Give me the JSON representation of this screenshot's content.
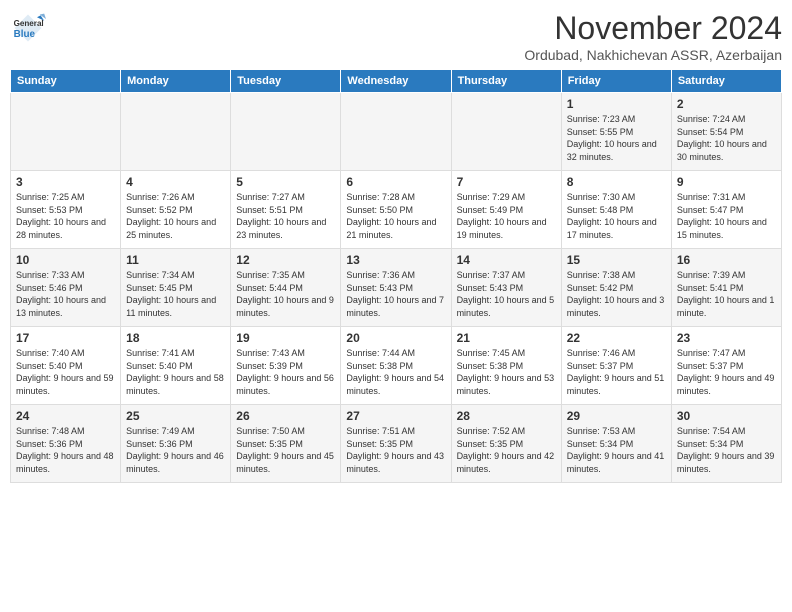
{
  "header": {
    "logo": {
      "general": "General",
      "blue": "Blue"
    },
    "title": "November 2024",
    "location": "Ordubad, Nakhichevan ASSR, Azerbaijan"
  },
  "weekdays": [
    "Sunday",
    "Monday",
    "Tuesday",
    "Wednesday",
    "Thursday",
    "Friday",
    "Saturday"
  ],
  "weeks": [
    [
      {
        "day": "",
        "info": ""
      },
      {
        "day": "",
        "info": ""
      },
      {
        "day": "",
        "info": ""
      },
      {
        "day": "",
        "info": ""
      },
      {
        "day": "",
        "info": ""
      },
      {
        "day": "1",
        "info": "Sunrise: 7:23 AM\nSunset: 5:55 PM\nDaylight: 10 hours and 32 minutes."
      },
      {
        "day": "2",
        "info": "Sunrise: 7:24 AM\nSunset: 5:54 PM\nDaylight: 10 hours and 30 minutes."
      }
    ],
    [
      {
        "day": "3",
        "info": "Sunrise: 7:25 AM\nSunset: 5:53 PM\nDaylight: 10 hours and 28 minutes."
      },
      {
        "day": "4",
        "info": "Sunrise: 7:26 AM\nSunset: 5:52 PM\nDaylight: 10 hours and 25 minutes."
      },
      {
        "day": "5",
        "info": "Sunrise: 7:27 AM\nSunset: 5:51 PM\nDaylight: 10 hours and 23 minutes."
      },
      {
        "day": "6",
        "info": "Sunrise: 7:28 AM\nSunset: 5:50 PM\nDaylight: 10 hours and 21 minutes."
      },
      {
        "day": "7",
        "info": "Sunrise: 7:29 AM\nSunset: 5:49 PM\nDaylight: 10 hours and 19 minutes."
      },
      {
        "day": "8",
        "info": "Sunrise: 7:30 AM\nSunset: 5:48 PM\nDaylight: 10 hours and 17 minutes."
      },
      {
        "day": "9",
        "info": "Sunrise: 7:31 AM\nSunset: 5:47 PM\nDaylight: 10 hours and 15 minutes."
      }
    ],
    [
      {
        "day": "10",
        "info": "Sunrise: 7:33 AM\nSunset: 5:46 PM\nDaylight: 10 hours and 13 minutes."
      },
      {
        "day": "11",
        "info": "Sunrise: 7:34 AM\nSunset: 5:45 PM\nDaylight: 10 hours and 11 minutes."
      },
      {
        "day": "12",
        "info": "Sunrise: 7:35 AM\nSunset: 5:44 PM\nDaylight: 10 hours and 9 minutes."
      },
      {
        "day": "13",
        "info": "Sunrise: 7:36 AM\nSunset: 5:43 PM\nDaylight: 10 hours and 7 minutes."
      },
      {
        "day": "14",
        "info": "Sunrise: 7:37 AM\nSunset: 5:43 PM\nDaylight: 10 hours and 5 minutes."
      },
      {
        "day": "15",
        "info": "Sunrise: 7:38 AM\nSunset: 5:42 PM\nDaylight: 10 hours and 3 minutes."
      },
      {
        "day": "16",
        "info": "Sunrise: 7:39 AM\nSunset: 5:41 PM\nDaylight: 10 hours and 1 minute."
      }
    ],
    [
      {
        "day": "17",
        "info": "Sunrise: 7:40 AM\nSunset: 5:40 PM\nDaylight: 9 hours and 59 minutes."
      },
      {
        "day": "18",
        "info": "Sunrise: 7:41 AM\nSunset: 5:40 PM\nDaylight: 9 hours and 58 minutes."
      },
      {
        "day": "19",
        "info": "Sunrise: 7:43 AM\nSunset: 5:39 PM\nDaylight: 9 hours and 56 minutes."
      },
      {
        "day": "20",
        "info": "Sunrise: 7:44 AM\nSunset: 5:38 PM\nDaylight: 9 hours and 54 minutes."
      },
      {
        "day": "21",
        "info": "Sunrise: 7:45 AM\nSunset: 5:38 PM\nDaylight: 9 hours and 53 minutes."
      },
      {
        "day": "22",
        "info": "Sunrise: 7:46 AM\nSunset: 5:37 PM\nDaylight: 9 hours and 51 minutes."
      },
      {
        "day": "23",
        "info": "Sunrise: 7:47 AM\nSunset: 5:37 PM\nDaylight: 9 hours and 49 minutes."
      }
    ],
    [
      {
        "day": "24",
        "info": "Sunrise: 7:48 AM\nSunset: 5:36 PM\nDaylight: 9 hours and 48 minutes."
      },
      {
        "day": "25",
        "info": "Sunrise: 7:49 AM\nSunset: 5:36 PM\nDaylight: 9 hours and 46 minutes."
      },
      {
        "day": "26",
        "info": "Sunrise: 7:50 AM\nSunset: 5:35 PM\nDaylight: 9 hours and 45 minutes."
      },
      {
        "day": "27",
        "info": "Sunrise: 7:51 AM\nSunset: 5:35 PM\nDaylight: 9 hours and 43 minutes."
      },
      {
        "day": "28",
        "info": "Sunrise: 7:52 AM\nSunset: 5:35 PM\nDaylight: 9 hours and 42 minutes."
      },
      {
        "day": "29",
        "info": "Sunrise: 7:53 AM\nSunset: 5:34 PM\nDaylight: 9 hours and 41 minutes."
      },
      {
        "day": "30",
        "info": "Sunrise: 7:54 AM\nSunset: 5:34 PM\nDaylight: 9 hours and 39 minutes."
      }
    ]
  ]
}
